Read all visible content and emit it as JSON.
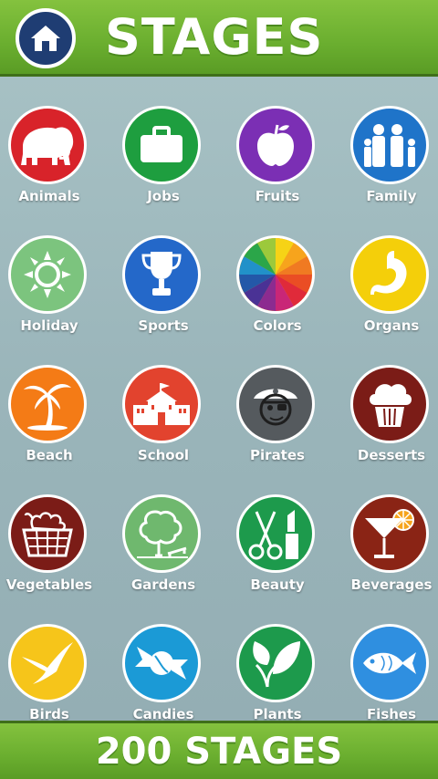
{
  "header": {
    "title": "STAGES"
  },
  "footer": {
    "label": "200 STAGES"
  },
  "stages": [
    {
      "label": "Animals",
      "icon": "mammoth-icon",
      "color": "#d8232a"
    },
    {
      "label": "Jobs",
      "icon": "briefcase-icon",
      "color": "#1e9e3f"
    },
    {
      "label": "Fruits",
      "icon": "apple-icon",
      "color": "#7b2fb4"
    },
    {
      "label": "Family",
      "icon": "family-icon",
      "color": "#1f74c9"
    },
    {
      "label": "Holiday",
      "icon": "sun-icon",
      "color": "#7cc47e"
    },
    {
      "label": "Sports",
      "icon": "trophy-icon",
      "color": "#2468c9"
    },
    {
      "label": "Colors",
      "icon": "color-wheel-icon",
      "color": "#f29a1f"
    },
    {
      "label": "Organs",
      "icon": "stomach-icon",
      "color": "#f4cf0a"
    },
    {
      "label": "Beach",
      "icon": "palm-tree-icon",
      "color": "#f47b16"
    },
    {
      "label": "School",
      "icon": "school-building-icon",
      "color": "#e2432e"
    },
    {
      "label": "Pirates",
      "icon": "pirate-icon",
      "color": "#555a5e"
    },
    {
      "label": "Desserts",
      "icon": "cupcake-icon",
      "color": "#7b1c17"
    },
    {
      "label": "Vegetables",
      "icon": "basket-icon",
      "color": "#7b1c17"
    },
    {
      "label": "Gardens",
      "icon": "tree-bench-icon",
      "color": "#6fb86e"
    },
    {
      "label": "Beauty",
      "icon": "scissors-lipstick-icon",
      "color": "#1d9a4c"
    },
    {
      "label": "Beverages",
      "icon": "cocktail-icon",
      "color": "#8a2415"
    },
    {
      "label": "Birds",
      "icon": "bird-icon",
      "color": "#f6c51a"
    },
    {
      "label": "Candies",
      "icon": "candy-icon",
      "color": "#1b9ad6"
    },
    {
      "label": "Plants",
      "icon": "leaves-icon",
      "color": "#1d9a4c"
    },
    {
      "label": "Fishes",
      "icon": "fish-icon",
      "color": "#2f8fe0"
    }
  ]
}
